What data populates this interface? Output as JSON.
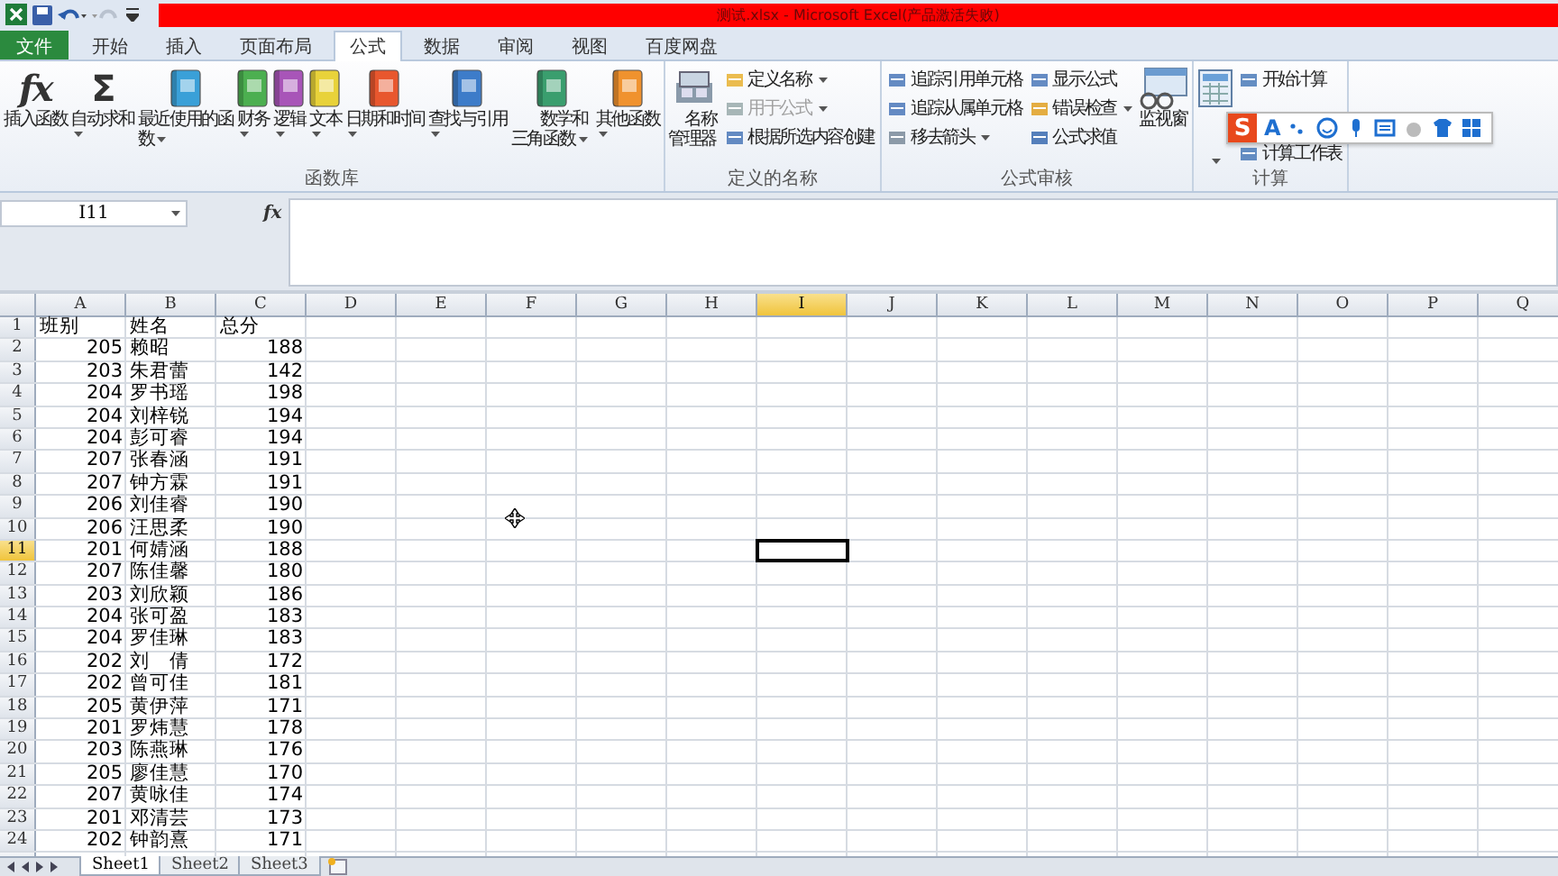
{
  "window": {
    "title": "测试.xlsx - Microsoft Excel(产品激活失败)"
  },
  "tabs": [
    {
      "label": "文件",
      "kind": "file",
      "selected": false
    },
    {
      "label": "开始",
      "kind": "tab",
      "selected": false
    },
    {
      "label": "插入",
      "kind": "tab",
      "selected": false
    },
    {
      "label": "页面布局",
      "kind": "tab",
      "selected": false
    },
    {
      "label": "公式",
      "kind": "tab",
      "selected": true
    },
    {
      "label": "数据",
      "kind": "tab",
      "selected": false
    },
    {
      "label": "审阅",
      "kind": "tab",
      "selected": false
    },
    {
      "label": "视图",
      "kind": "tab",
      "selected": false
    },
    {
      "label": "百度网盘",
      "kind": "tab",
      "selected": false
    }
  ],
  "ribbon": {
    "groups": [
      {
        "label": "函数库",
        "items": [
          {
            "kind": "large",
            "label": "插入函数",
            "symbol": "fx",
            "dropdown": false,
            "disabled": false
          },
          {
            "kind": "large",
            "label": "自动求和",
            "symbol": "Σ",
            "dropdown": true,
            "disabled": false
          },
          {
            "kind": "large",
            "label": "最近使用的函数",
            "dropdown": true,
            "disabled": false
          },
          {
            "kind": "large",
            "label": "财务",
            "dropdown": true,
            "disabled": false
          },
          {
            "kind": "large",
            "label": "逻辑",
            "dropdown": true,
            "disabled": false
          },
          {
            "kind": "large",
            "label": "文本",
            "dropdown": true,
            "disabled": false
          },
          {
            "kind": "large",
            "label": "日期和时间",
            "dropdown": true,
            "disabled": false
          },
          {
            "kind": "large",
            "label": "查找与引用",
            "dropdown": true,
            "disabled": false
          },
          {
            "kind": "large",
            "label": "数学和三角函数",
            "dropdown": true,
            "disabled": false
          },
          {
            "kind": "large",
            "label": "其他函数",
            "dropdown": true,
            "disabled": false
          }
        ]
      },
      {
        "label": "定义的名称",
        "items": [
          {
            "kind": "large",
            "label": "名称管理器",
            "dropdown": false,
            "disabled": false
          },
          {
            "kind": "small",
            "label": "定义名称",
            "dropdown": true,
            "disabled": false
          },
          {
            "kind": "small",
            "label": "用于公式",
            "dropdown": true,
            "disabled": true
          },
          {
            "kind": "small",
            "label": "根据所选内容创建",
            "dropdown": false,
            "disabled": false
          }
        ]
      },
      {
        "label": "公式审核",
        "items": [
          {
            "kind": "small",
            "label": "追踪引用单元格",
            "dropdown": false,
            "disabled": false
          },
          {
            "kind": "small",
            "label": "追踪从属单元格",
            "dropdown": false,
            "disabled": false
          },
          {
            "kind": "small",
            "label": "移去箭头",
            "dropdown": true,
            "disabled": false
          },
          {
            "kind": "small",
            "label": "显示公式",
            "dropdown": false,
            "disabled": false
          },
          {
            "kind": "small",
            "label": "错误检查",
            "dropdown": true,
            "disabled": false
          },
          {
            "kind": "small",
            "label": "公式求值",
            "dropdown": false,
            "disabled": false
          },
          {
            "kind": "large",
            "label": "监视窗",
            "dropdown": false,
            "disabled": false
          }
        ]
      },
      {
        "label": "计算",
        "items": [
          {
            "kind": "large",
            "dropdown": true,
            "disabled": false
          },
          {
            "kind": "small",
            "label": "开始计算",
            "dropdown": false,
            "disabled": false
          },
          {
            "kind": "small",
            "label": "计算工作表",
            "dropdown": false,
            "disabled": false
          }
        ]
      }
    ]
  },
  "ime_toolbar": {
    "logo": "S",
    "items": [
      "A"
    ]
  },
  "formula_bar": {
    "name_box": "I11",
    "fx": "fx"
  },
  "grid": {
    "columns": [
      {
        "label": "A",
        "numeric": true,
        "selected": false
      },
      {
        "label": "B",
        "numeric": false,
        "selected": false
      },
      {
        "label": "C",
        "numeric": true,
        "selected": false
      },
      {
        "label": "D",
        "selected": false
      },
      {
        "label": "E",
        "selected": false
      },
      {
        "label": "F",
        "selected": false
      },
      {
        "label": "G",
        "selected": false
      },
      {
        "label": "H",
        "selected": false
      },
      {
        "label": "I",
        "selected": true
      },
      {
        "label": "J",
        "selected": false
      },
      {
        "label": "K",
        "selected": false
      },
      {
        "label": "L",
        "selected": false
      },
      {
        "label": "M",
        "selected": false
      },
      {
        "label": "N",
        "selected": false
      },
      {
        "label": "O",
        "selected": false
      },
      {
        "label": "P",
        "selected": false
      },
      {
        "label": "Q",
        "selected": false
      }
    ],
    "rows": [
      {
        "label": "1",
        "kind": "header",
        "selected": false,
        "cells": [
          "班别",
          "姓名",
          "总分"
        ]
      },
      {
        "label": "2",
        "kind": "data",
        "selected": false,
        "cells": [
          "205",
          "赖昭",
          "188"
        ]
      },
      {
        "label": "3",
        "kind": "data",
        "selected": false,
        "cells": [
          "203",
          "朱君蕾",
          "142"
        ]
      },
      {
        "label": "4",
        "kind": "data",
        "selected": false,
        "cells": [
          "204",
          "罗书瑶",
          "198"
        ]
      },
      {
        "label": "5",
        "kind": "data",
        "selected": false,
        "cells": [
          "204",
          "刘梓锐",
          "194"
        ]
      },
      {
        "label": "6",
        "kind": "data",
        "selected": false,
        "cells": [
          "204",
          "彭可睿",
          "194"
        ]
      },
      {
        "label": "7",
        "kind": "data",
        "selected": false,
        "cells": [
          "207",
          "张春涵",
          "191"
        ]
      },
      {
        "label": "8",
        "kind": "data",
        "selected": false,
        "cells": [
          "207",
          "钟方霖",
          "191"
        ]
      },
      {
        "label": "9",
        "kind": "data",
        "selected": false,
        "cells": [
          "206",
          "刘佳睿",
          "190"
        ]
      },
      {
        "label": "10",
        "kind": "data",
        "selected": false,
        "cells": [
          "206",
          "汪思柔",
          "190"
        ]
      },
      {
        "label": "11",
        "kind": "data",
        "selected": true,
        "cells": [
          "201",
          "何婧涵",
          "188"
        ]
      },
      {
        "label": "12",
        "kind": "data",
        "selected": false,
        "cells": [
          "207",
          "陈佳馨",
          "180"
        ]
      },
      {
        "label": "13",
        "kind": "data",
        "selected": false,
        "cells": [
          "203",
          "刘欣颖",
          "186"
        ]
      },
      {
        "label": "14",
        "kind": "data",
        "selected": false,
        "cells": [
          "204",
          "张可盈",
          "183"
        ]
      },
      {
        "label": "15",
        "kind": "data",
        "selected": false,
        "cells": [
          "204",
          "罗佳琳",
          "183"
        ]
      },
      {
        "label": "16",
        "kind": "data",
        "selected": false,
        "cells": [
          "202",
          "刘　倩",
          "172"
        ]
      },
      {
        "label": "17",
        "kind": "data",
        "selected": false,
        "cells": [
          "202",
          "曾可佳",
          "181"
        ]
      },
      {
        "label": "18",
        "kind": "data",
        "selected": false,
        "cells": [
          "205",
          "黄伊萍",
          "171"
        ]
      },
      {
        "label": "19",
        "kind": "data",
        "selected": false,
        "cells": [
          "201",
          "罗炜慧",
          "178"
        ]
      },
      {
        "label": "20",
        "kind": "data",
        "selected": false,
        "cells": [
          "203",
          "陈燕琳",
          "176"
        ]
      },
      {
        "label": "21",
        "kind": "data",
        "selected": false,
        "cells": [
          "205",
          "廖佳慧",
          "170"
        ]
      },
      {
        "label": "22",
        "kind": "data",
        "selected": false,
        "cells": [
          "207",
          "黄咏佳",
          "174"
        ]
      },
      {
        "label": "23",
        "kind": "data",
        "selected": false,
        "cells": [
          "201",
          "邓清芸",
          "173"
        ]
      },
      {
        "label": "24",
        "kind": "data",
        "selected": false,
        "cells": [
          "202",
          "钟韵熹",
          "171"
        ]
      }
    ]
  },
  "sheet_tabs": [
    {
      "label": "Sheet1",
      "selected": true
    },
    {
      "label": "Sheet2",
      "selected": false
    },
    {
      "label": "Sheet3",
      "selected": false
    }
  ]
}
